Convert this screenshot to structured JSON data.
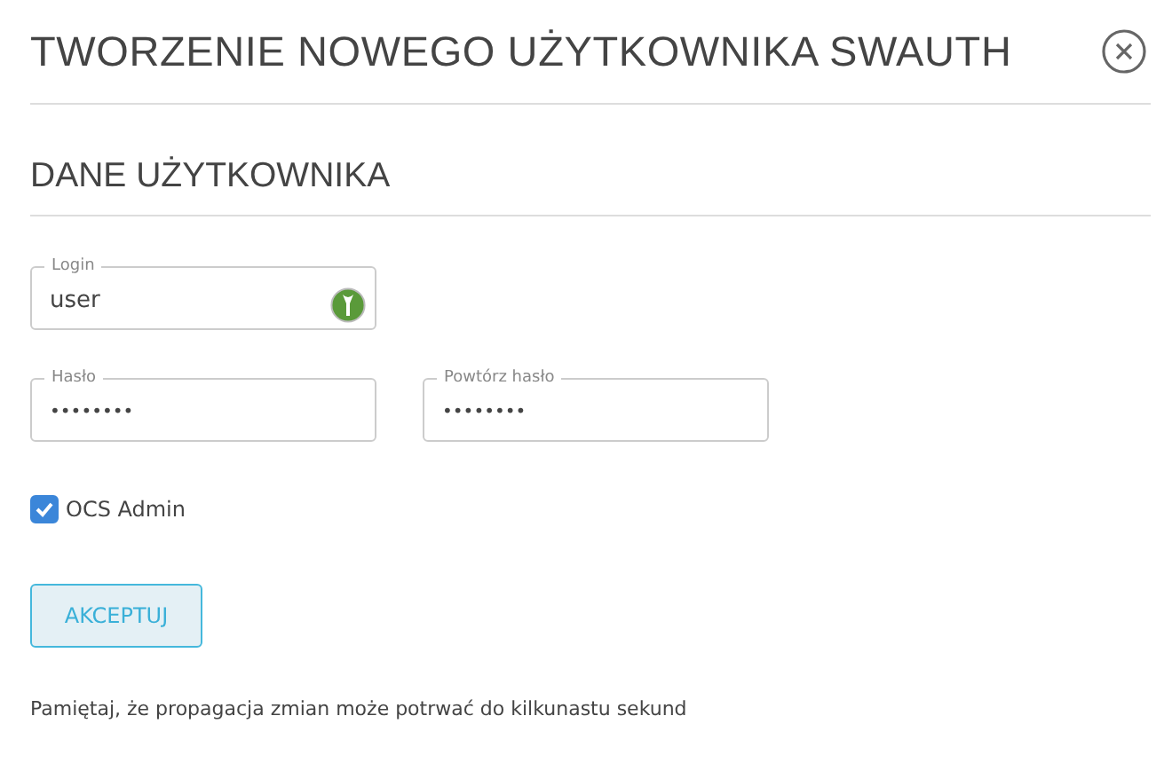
{
  "title": "TWORZENIE NOWEGO UŻYTKOWNIKA SWAUTH",
  "section": "DANE UŻYTKOWNIKA",
  "fields": [
    {
      "label": "Login",
      "value": "user",
      "kind": "login"
    },
    {
      "label": "Hasło",
      "value": "••••••••",
      "kind": "password"
    },
    {
      "label": "Powtórz hasło",
      "value": "••••••••",
      "kind": "password"
    }
  ],
  "checkbox": {
    "label": "OCS Admin",
    "checked": true
  },
  "button": "AKCEPTUJ",
  "note": "Pamiętaj, że propagacja zmian może potrwać do kilkunastu sekund"
}
